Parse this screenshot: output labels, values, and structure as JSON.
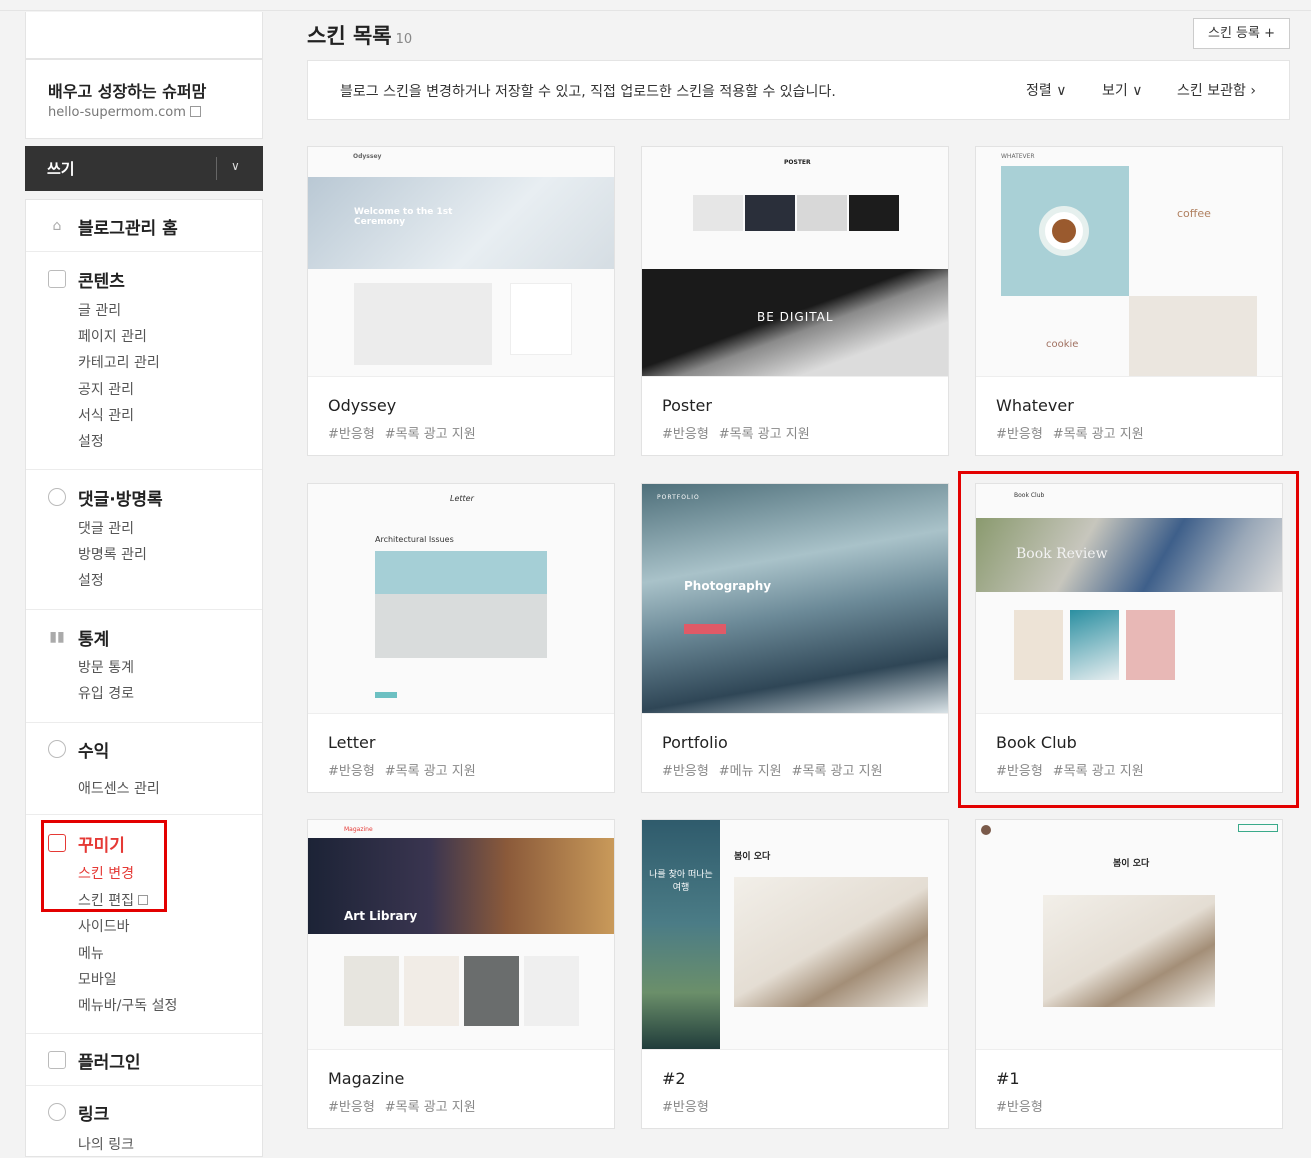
{
  "blog": {
    "title": "배우고 성장하는 슈퍼맘",
    "url": "hello-supermom.com"
  },
  "write": {
    "label": "쓰기"
  },
  "menu": {
    "home": "블로그관리 홈",
    "content": {
      "title": "콘텐츠",
      "items": [
        "글 관리",
        "페이지 관리",
        "카테고리 관리",
        "공지 관리",
        "서식 관리",
        "설정"
      ]
    },
    "comments": {
      "title": "댓글·방명록",
      "items": [
        "댓글 관리",
        "방명록 관리",
        "설정"
      ]
    },
    "stats": {
      "title": "통계",
      "items": [
        "방문 통계",
        "유입 경로"
      ]
    },
    "revenue": {
      "title": "수익",
      "items": [
        "애드센스 관리"
      ]
    },
    "decorate": {
      "title": "꾸미기",
      "items": [
        "스킨 변경",
        "스킨 편집",
        "사이드바",
        "메뉴",
        "모바일",
        "메뉴바/구독 설정"
      ]
    },
    "plugin": {
      "title": "플러그인"
    },
    "link": {
      "title": "링크",
      "items": [
        "나의 링크"
      ]
    }
  },
  "page": {
    "title": "스킨 목록",
    "count": "10",
    "register": "스킨 등록 +",
    "info": "블로그 스킨을 변경하거나 저장할 수 있고, 직접 업로드한 스킨을 적용할 수 있습니다.",
    "sort": "정렬",
    "view": "보기",
    "storage": "스킨 보관함"
  },
  "skins": [
    {
      "name": "Odyssey",
      "tags": [
        "#반응형",
        "#목록 광고 지원"
      ],
      "preview": {
        "brand": "Odyssey",
        "hero": "Welcome to the 1st Ceremony"
      }
    },
    {
      "name": "Poster",
      "tags": [
        "#반응형",
        "#목록 광고 지원"
      ],
      "preview": {
        "brand": "POSTER",
        "hero": "BE DIGITAL"
      }
    },
    {
      "name": "Whatever",
      "tags": [
        "#반응형",
        "#목록 광고 지원"
      ],
      "preview": {
        "brand": "WHATEVER",
        "word1": "coffee",
        "word2": "cookie"
      }
    },
    {
      "name": "Letter",
      "tags": [
        "#반응형",
        "#목록 광고 지원"
      ],
      "preview": {
        "brand": "Letter",
        "heading": "Architectural Issues"
      }
    },
    {
      "name": "Portfolio",
      "tags": [
        "#반응형",
        "#메뉴 지원",
        "#목록 광고 지원"
      ],
      "preview": {
        "brand": "PORTFOLIO",
        "hero": "Photography"
      }
    },
    {
      "name": "Book Club",
      "tags": [
        "#반응형",
        "#목록 광고 지원"
      ],
      "preview": {
        "brand": "Book Club",
        "hero": "Book Review"
      }
    },
    {
      "name": "Magazine",
      "tags": [
        "#반응형",
        "#목록 광고 지원"
      ],
      "preview": {
        "brand": "Magazine",
        "hero": "Art Library"
      }
    },
    {
      "name": "#2",
      "tags": [
        "#반응형"
      ],
      "preview": {
        "side": "나를 찾아 떠나는 여행",
        "heading": "봄이 오다"
      }
    },
    {
      "name": "#1",
      "tags": [
        "#반응형"
      ],
      "preview": {
        "heading": "봄이 오다"
      }
    }
  ]
}
